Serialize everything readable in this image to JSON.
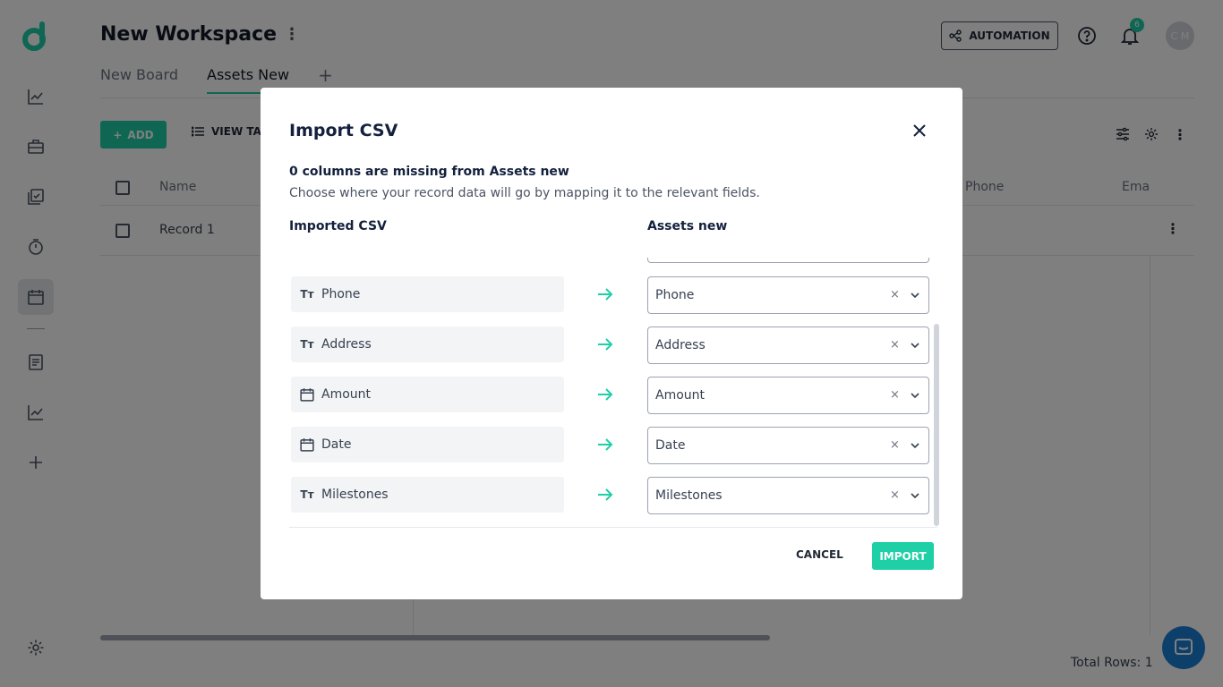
{
  "workspace": {
    "title": "New Workspace",
    "menu_glyph": "⋮"
  },
  "tabs": [
    {
      "label": "New Board"
    },
    {
      "label": "Assets New"
    }
  ],
  "tab_add_glyph": "+",
  "header": {
    "automation_label": "AUTOMATION",
    "notification_count": "6",
    "avatar_initials": "C M"
  },
  "toolbar": {
    "add_label": "ADD",
    "view_table_label": "VIEW TAB"
  },
  "table": {
    "columns": [
      "Name",
      "Phone",
      "Ema"
    ],
    "rows": [
      {
        "name": "Record 1"
      }
    ],
    "total_rows": "Total Rows: 1"
  },
  "modal": {
    "title": "Import CSV",
    "missing_text": "0 columns are missing from Assets new",
    "help_text": "Choose where your record data will go by mapping it to the relevant fields.",
    "left_header": "Imported CSV",
    "right_header": "Assets new",
    "clear_glyph": "×",
    "mappings": [
      {
        "source": "Phone",
        "source_type": "text-type-icon",
        "target": "Phone"
      },
      {
        "source": "Address",
        "source_type": "text-type-icon",
        "target": "Address"
      },
      {
        "source": "Amount",
        "source_type": "calendar-type-icon",
        "target": "Amount"
      },
      {
        "source": "Date",
        "source_type": "calendar-type-icon",
        "target": "Date"
      },
      {
        "source": "Milestones",
        "source_type": "text-type-icon",
        "target": "Milestones"
      }
    ],
    "cancel_label": "CANCEL",
    "import_label": "IMPORT"
  },
  "colors": {
    "accent": "#1fcfa6",
    "chat": "#1b7fd6",
    "overlay": "rgba(0,0,0,0.5)"
  }
}
